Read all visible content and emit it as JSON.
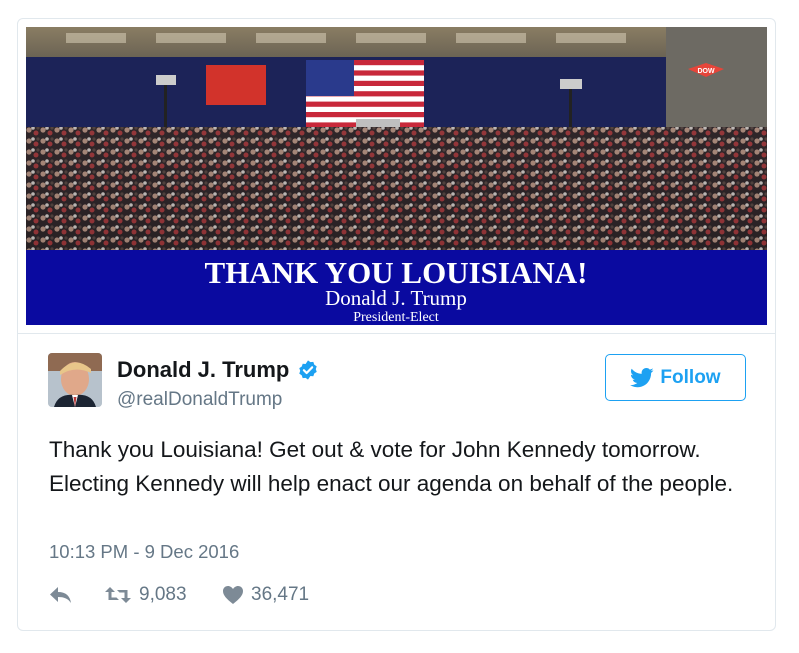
{
  "media": {
    "headline": "THANK YOU LOUISIANA!",
    "name": "Donald J. Trump",
    "subtitle": "President-Elect",
    "banner_color": "#0a0aa0",
    "sign_text": "DOW"
  },
  "user": {
    "name": "Donald J. Trump",
    "handle": "@realDonaldTrump",
    "verified": true
  },
  "follow_button": {
    "label": "Follow",
    "color": "#1da1f2"
  },
  "tweet": {
    "text": "Thank you Louisiana! Get out & vote for John Kennedy tomorrow. Electing Kennedy will help enact our agenda on behalf of the people.",
    "timestamp": "10:13 PM - 9 Dec 2016"
  },
  "actions": {
    "reply_icon": "reply-icon",
    "retweet_count": "9,083",
    "like_count": "36,471"
  }
}
